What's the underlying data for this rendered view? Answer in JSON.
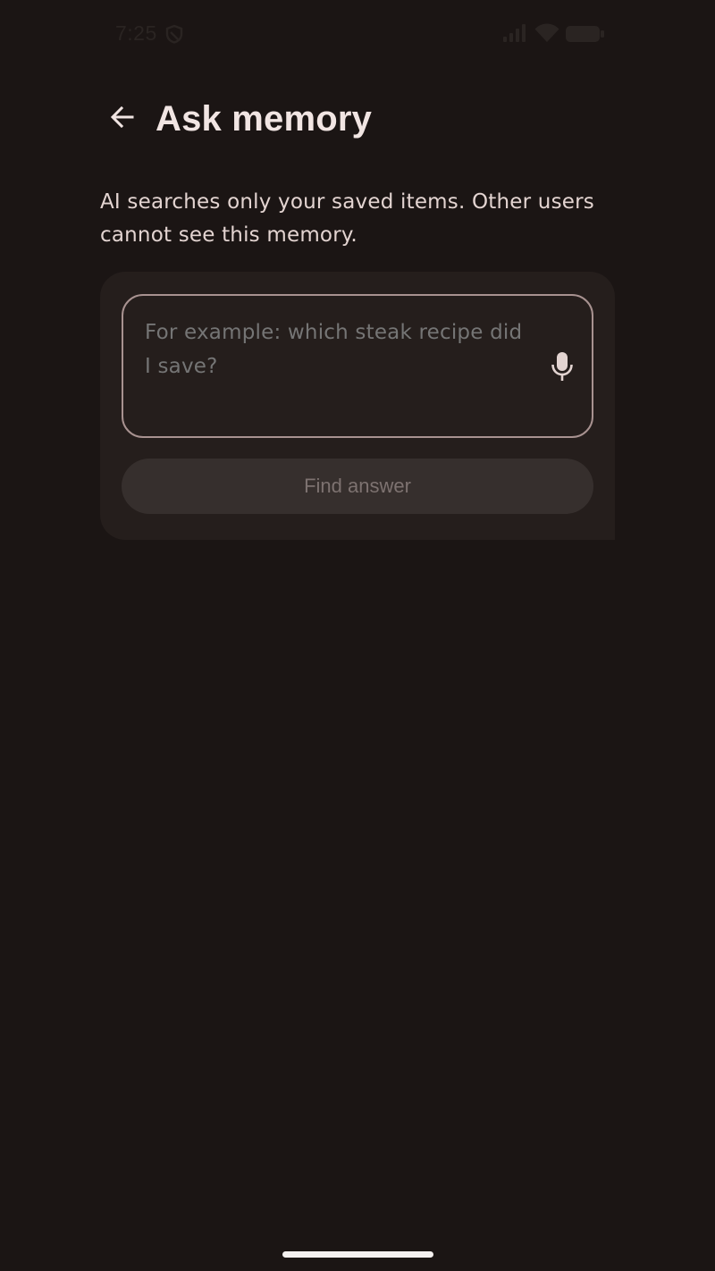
{
  "status_bar": {
    "time": "7:25",
    "icons": [
      "shield-icon",
      "cellular-signal-icon",
      "wifi-icon",
      "battery-icon"
    ]
  },
  "header": {
    "back_icon": "arrow-left-icon",
    "title": "Ask memory"
  },
  "description": "AI searches only your saved items. Other users cannot see this memory.",
  "query": {
    "value": "",
    "placeholder": "For example: which steak recipe did I save?",
    "mic_icon": "microphone-icon"
  },
  "find_button": {
    "label": "Find answer",
    "enabled": false
  },
  "colors": {
    "background": "#1b1514",
    "card": "#251e1c",
    "field_border": "#a89290",
    "button_disabled_bg": "#362f2d",
    "button_disabled_text": "#7d7270",
    "text_primary": "#f1e5e3",
    "text_secondary": "#e3d4d1"
  }
}
